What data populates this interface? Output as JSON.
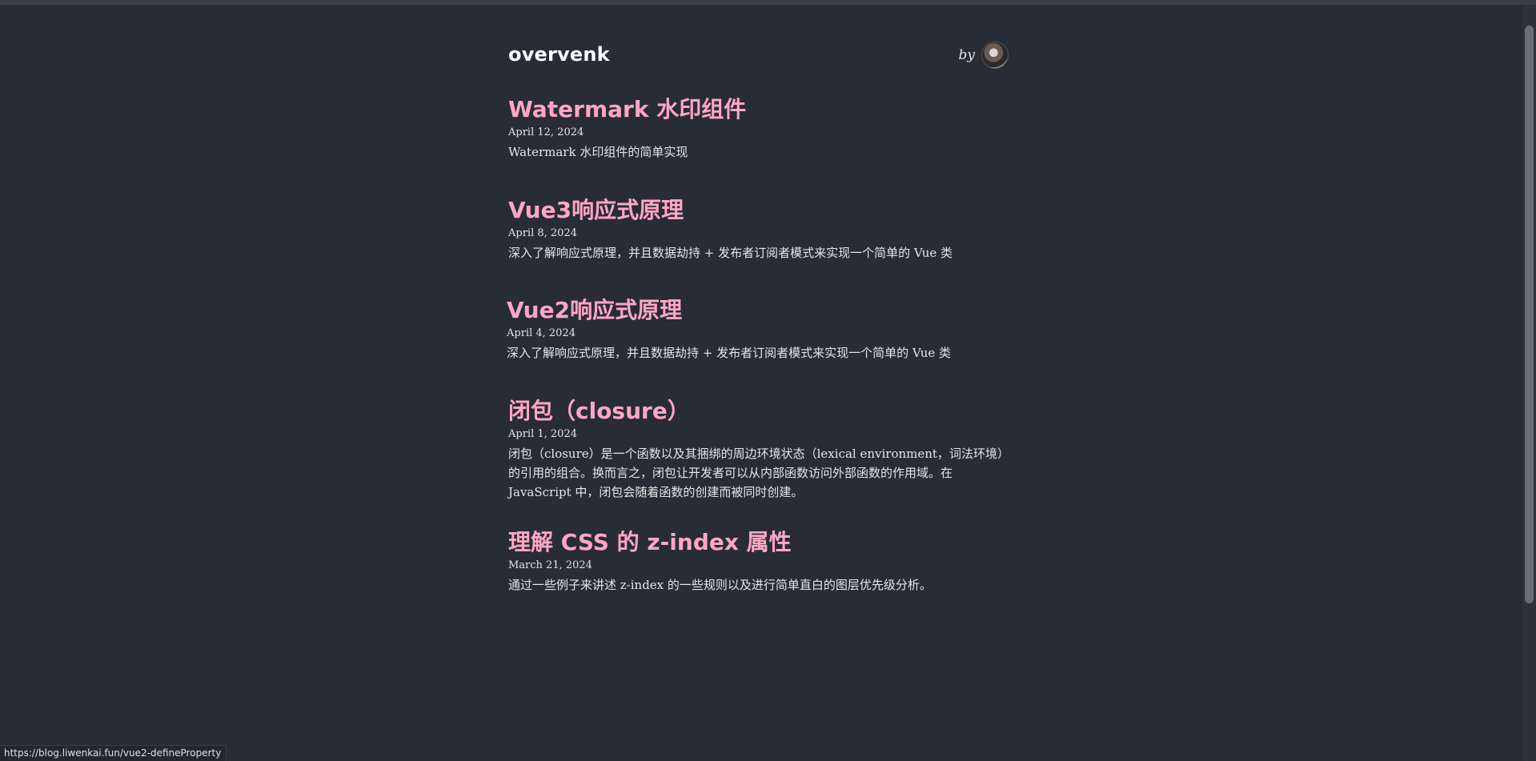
{
  "site": {
    "title": "overvenk",
    "by_label": "by"
  },
  "posts": [
    {
      "title": "Watermark 水印组件",
      "date": "April 12, 2024",
      "excerpt": "Watermark 水印组件的简单实现"
    },
    {
      "title": "Vue3响应式原理",
      "date": "April 8, 2024",
      "excerpt": "深入了解响应式原理，并且数据劫持 + 发布者订阅者模式来实现一个简单的 Vue 类"
    },
    {
      "title": "Vue2响应式原理",
      "date": "April 4, 2024",
      "excerpt": "深入了解响应式原理，并且数据劫持 + 发布者订阅者模式来实现一个简单的 Vue 类"
    },
    {
      "title": "闭包（closure）",
      "date": "April 1, 2024",
      "excerpt": "闭包（closure）是一个函数以及其捆绑的周边环境状态（lexical environment，词法环境）的引用的组合。换而言之，闭包让开发者可以从内部函数访问外部函数的作用域。在 JavaScript 中，闭包会随着函数的创建而被同时创建。"
    },
    {
      "title": "理解 CSS 的 z-index 属性",
      "date": "March 21, 2024",
      "excerpt": "通过一些例子来讲述 z-index 的一些规则以及进行简单直白的图层优先级分析。"
    }
  ],
  "status_bar": {
    "url": "https://blog.liwenkai.fun/vue2-defineProperty"
  },
  "colors": {
    "background": "#282c35",
    "link": "#ffa7c4",
    "text": "#e6e6e6"
  }
}
